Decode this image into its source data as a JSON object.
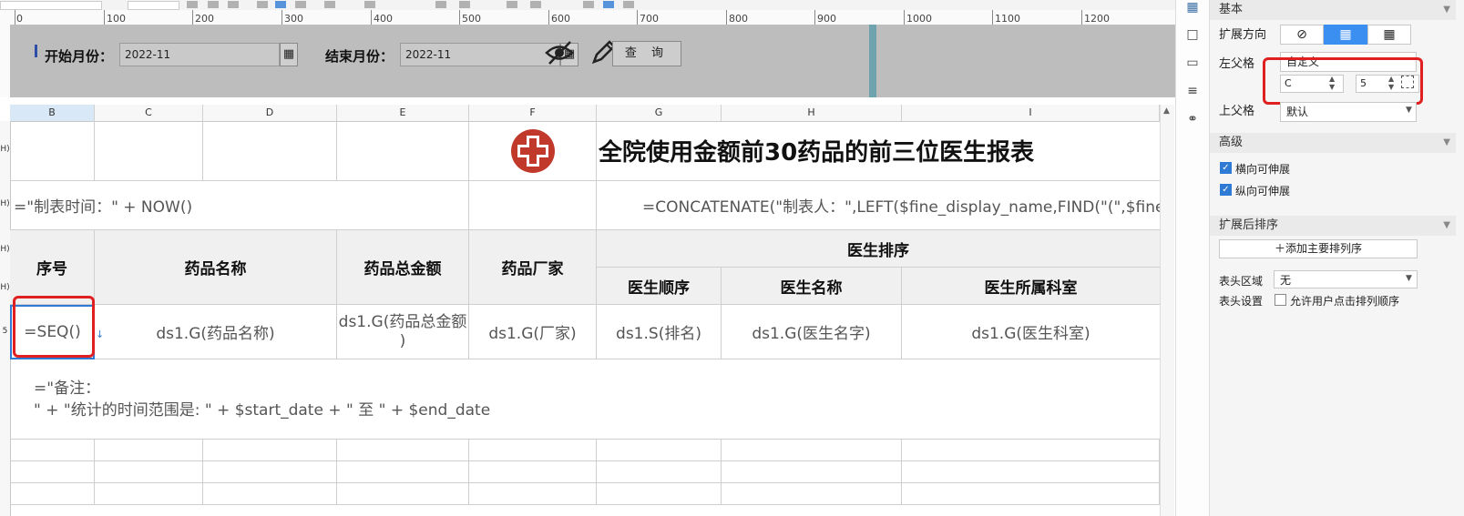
{
  "ruler": {
    "ticks": [
      "0",
      "100",
      "200",
      "300",
      "400",
      "500",
      "600",
      "700",
      "800",
      "900",
      "1000",
      "1100",
      "1200"
    ]
  },
  "param_panel": {
    "start_label": "开始月份：",
    "start_value": "2022-11",
    "end_label": "结束月份：",
    "end_value": "2022-11",
    "query_label": "查 询"
  },
  "columns": [
    "B",
    "C",
    "D",
    "E",
    "F",
    "G",
    "H",
    "I"
  ],
  "row_heads": [
    "H)",
    "H)",
    "H)",
    "H)",
    "5",
    "",
    "",
    "",
    ""
  ],
  "report": {
    "title": "全院使用金额前30药品的前三位医生报表",
    "time_formula": "=\"制表时间：\" + NOW()",
    "maker_formula": "=CONCATENATE(\"制表人：\",LEFT($fine_display_name,FIND(\"(\",$fine",
    "headers": {
      "seq": "序号",
      "drug_name": "药品名称",
      "drug_total": "药品总金额",
      "maker": "药品厂家",
      "doctor_rank": "医生排序",
      "doctor_order": "医生顺序",
      "doctor_name": "医生名称",
      "doctor_dept": "医生所属科室"
    },
    "data_row": {
      "seq": "=SEQ()",
      "drug_name": "ds1.G(药品名称)",
      "drug_total_1": "ds1.G(药品总金额",
      "drug_total_2": ")",
      "maker": "ds1.G(厂家)",
      "rank": "ds1.S(排名)",
      "doctor_name": "ds1.G(医生名字)",
      "doctor_dept": "ds1.G(医生科室)"
    },
    "note_line1": "=\"备注：",
    "note_line2": "\" + \"统计的时间范围是: \" + $start_date + \" 至 \" + $end_date"
  },
  "panel": {
    "sec_basic": "基本",
    "expand_dir_label": "扩展方向",
    "left_parent_label": "左父格",
    "left_parent_value": "自定义",
    "left_col": "C",
    "left_row": "5",
    "up_parent_label": "上父格",
    "up_parent_value": "默认",
    "sec_advanced": "高级",
    "h_expand": "横向可伸展",
    "v_expand": "纵向可伸展",
    "sec_sort": "扩展后排序",
    "add_sort": "添加主要排列序",
    "header_area_label": "表头区域",
    "header_area_value": "无",
    "header_setting_label": "表头设置",
    "allow_sort": "允许用户点击排列顺序"
  },
  "colors": {
    "accent": "#2f7ad5",
    "highlight": "#e02020",
    "logo": "#c0392b"
  }
}
